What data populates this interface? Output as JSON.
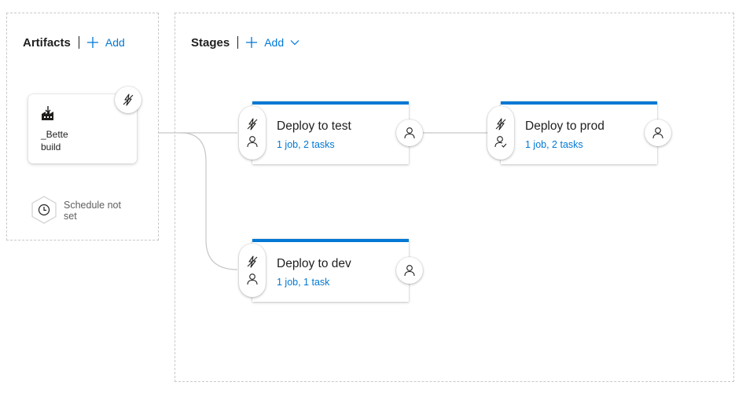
{
  "artifacts": {
    "title": "Artifacts",
    "add_label": "Add",
    "items": [
      {
        "name": "_Bette build",
        "icon": "build-factory-icon"
      }
    ],
    "schedule_label": "Schedule not set"
  },
  "stages": {
    "title": "Stages",
    "add_label": "Add",
    "items": [
      {
        "name": "Deploy to test",
        "summary": "1 job, 2 tasks"
      },
      {
        "name": "Deploy to prod",
        "summary": "1 job, 2 tasks"
      },
      {
        "name": "Deploy to dev",
        "summary": "1 job, 1 task"
      }
    ]
  },
  "colors": {
    "accent": "#0078d4",
    "text": "#201f1e",
    "muted": "#605e5c",
    "connector": "#c8c6c4"
  },
  "icons": {
    "trigger": "lightning-bolt-icon",
    "pre_approval": "person-icon",
    "post_approval": "person-icon",
    "approval_gate": "person-check-icon",
    "schedule": "clock-icon",
    "add": "plus-icon",
    "dropdown": "chevron-down-icon"
  }
}
